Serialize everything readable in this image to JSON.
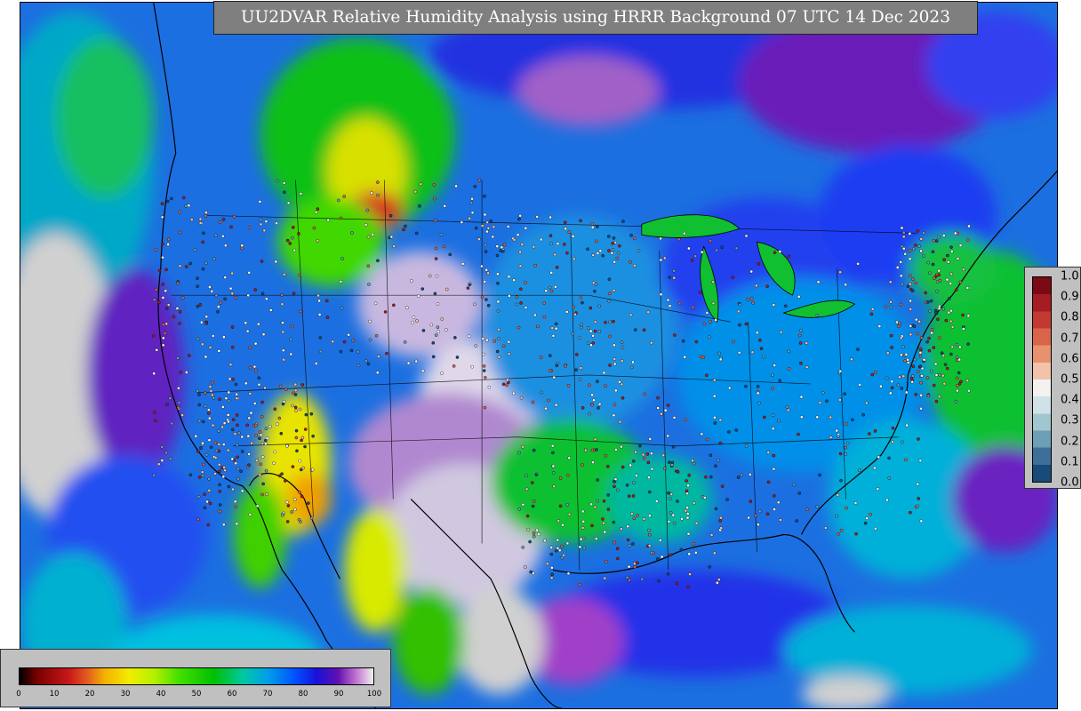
{
  "title": "UU2DVAR Relative Humidity Analysis using HRRR Background 07 UTC 14 Dec 2023",
  "rh_colorbar": {
    "ticks": [
      "0",
      "10",
      "20",
      "30",
      "40",
      "50",
      "60",
      "70",
      "80",
      "90",
      "100"
    ],
    "stops": [
      {
        "at": 0.0,
        "color": "#000000"
      },
      {
        "at": 0.05,
        "color": "#7a0000"
      },
      {
        "at": 0.14,
        "color": "#c81818"
      },
      {
        "at": 0.19,
        "color": "#e05a20"
      },
      {
        "at": 0.24,
        "color": "#f5b000"
      },
      {
        "at": 0.31,
        "color": "#f2ec00"
      },
      {
        "at": 0.38,
        "color": "#b6f000"
      },
      {
        "at": 0.45,
        "color": "#44e000"
      },
      {
        "at": 0.55,
        "color": "#00c000"
      },
      {
        "at": 0.63,
        "color": "#00c8a0"
      },
      {
        "at": 0.7,
        "color": "#00a0e8"
      },
      {
        "at": 0.78,
        "color": "#0050ff"
      },
      {
        "at": 0.84,
        "color": "#1a10d8"
      },
      {
        "at": 0.9,
        "color": "#6010b0"
      },
      {
        "at": 0.95,
        "color": "#c070d0"
      },
      {
        "at": 1.0,
        "color": "#f0f0f0"
      }
    ]
  },
  "weight_colorbar": {
    "ticks": [
      "1.0",
      "0.9",
      "0.8",
      "0.7",
      "0.6",
      "0.5",
      "0.4",
      "0.3",
      "0.2",
      "0.1",
      "0.0"
    ],
    "colors": [
      "#7b0a14",
      "#a51d22",
      "#c4392f",
      "#d8644a",
      "#e8916f",
      "#f2c2aa",
      "#f4f2f0",
      "#d0e2e8",
      "#a2c6d0",
      "#6e9fb8",
      "#3d6f99",
      "#184a7a"
    ]
  },
  "colors": {
    "ocean_base": "#1c6fe0",
    "land_base": "#1890d0",
    "frame_bg": "#c0c0c0",
    "title_bg": "#7f7f7f"
  }
}
